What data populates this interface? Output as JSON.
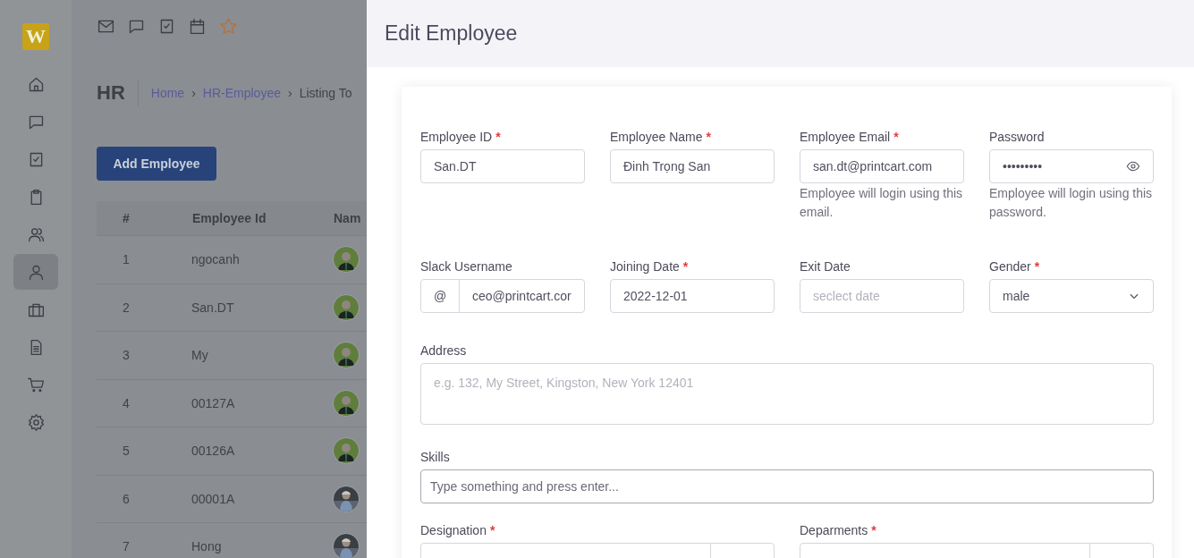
{
  "sidebar": {
    "logo": "W",
    "items": [
      {
        "selected": false
      },
      {
        "selected": false
      },
      {
        "selected": false
      },
      {
        "selected": false
      },
      {
        "selected": false
      },
      {
        "selected": true
      },
      {
        "selected": false
      },
      {
        "selected": false
      },
      {
        "selected": false
      },
      {
        "selected": false
      }
    ]
  },
  "page_header": {
    "title": "HR",
    "breadcrumb": [
      {
        "kind": "link",
        "text": "Home"
      },
      {
        "kind": "separator",
        "text": "›"
      },
      {
        "kind": "link",
        "text": "HR-Employee"
      },
      {
        "kind": "separator",
        "text": "›"
      },
      {
        "kind": "current",
        "text": "Listing To"
      }
    ]
  },
  "add_button": "Add Employee",
  "table": {
    "columns": [
      "#",
      "Employee Id",
      "Nam"
    ],
    "rows": [
      {
        "number": "1",
        "employee_id": "ngocanh"
      },
      {
        "number": "2",
        "employee_id": "San.DT"
      },
      {
        "number": "3",
        "employee_id": "My"
      },
      {
        "number": "4",
        "employee_id": "00127A"
      },
      {
        "number": "5",
        "employee_id": "00126A"
      },
      {
        "number": "6",
        "employee_id": "00001A"
      },
      {
        "number": "7",
        "employee_id": "Hong"
      }
    ]
  },
  "drawer": {
    "title": "Edit Employee",
    "fields": [
      {
        "kind": "text",
        "label": "Employee ID",
        "required_mark": "*",
        "value": "San.DT"
      },
      {
        "kind": "text",
        "label": "Employee Name",
        "required_mark": "*",
        "value": "Đinh Trọng San"
      },
      {
        "kind": "text",
        "label": "Employee Email",
        "required_mark": "*",
        "value": "san.dt@printcart.com",
        "help": "Employee will login using this email."
      },
      {
        "kind": "password",
        "label": "Password",
        "value": "•••••••••",
        "help": "Employee will login using this password."
      },
      {
        "kind": "prefixed",
        "label": "Slack Username",
        "prefix": "@",
        "value": "ceo@printcart.cor"
      },
      {
        "kind": "text",
        "label": "Joining Date",
        "required_mark": "*",
        "value": "2022-12-01"
      },
      {
        "kind": "text",
        "label": "Exit Date",
        "placeholder": "seclect date"
      },
      {
        "kind": "select",
        "label": "Gender",
        "required_mark": "*",
        "value": "male"
      },
      {
        "kind": "textarea",
        "label": "Address",
        "placeholder": "e.g. 132, My Street, Kingston, New York 12401"
      },
      {
        "kind": "tags",
        "label": "Skills",
        "placeholder": "Type something and press enter..."
      },
      {
        "kind": "suffixed",
        "label": "Designation",
        "required_mark": "*"
      },
      {
        "kind": "suffixed",
        "label": "Deparments",
        "required_mark": "*"
      }
    ]
  }
}
